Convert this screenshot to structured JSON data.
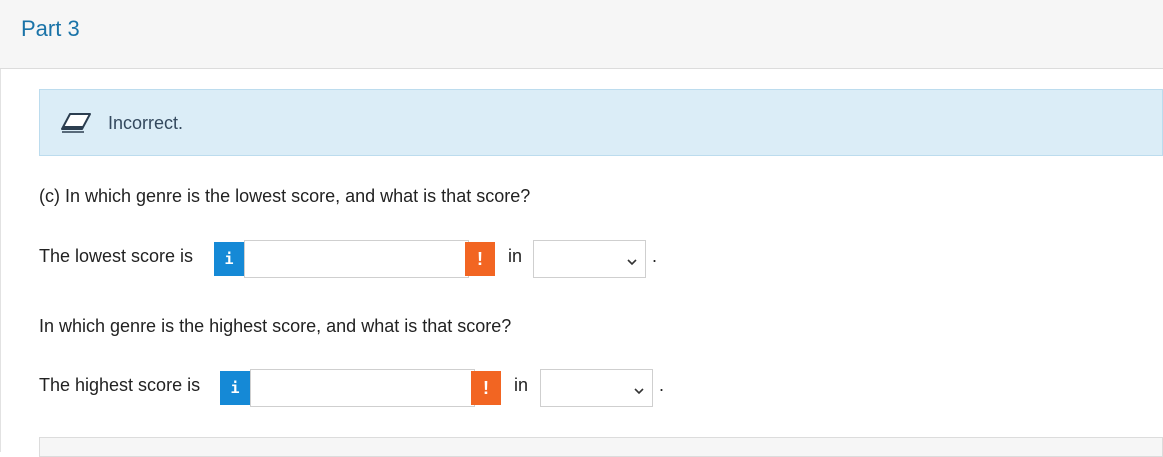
{
  "header": {
    "title": "Part 3"
  },
  "feedback": {
    "icon": "eraser-icon",
    "message": "Incorrect."
  },
  "question_c": {
    "text": "(c) In which genre is the lowest score, and what is that score?"
  },
  "lowest": {
    "label": "The lowest score is",
    "info_glyph": "i",
    "value": "",
    "warning_glyph": "!",
    "in_text": "in",
    "genre_selected": "",
    "period": "."
  },
  "question_high": {
    "text": "In which genre is the highest score, and what is that score?"
  },
  "highest": {
    "label": "The highest score is",
    "info_glyph": "i",
    "value": "",
    "warning_glyph": "!",
    "in_text": "in",
    "genre_selected": "",
    "period": "."
  },
  "colors": {
    "title": "#1a73a8",
    "alert_bg": "#dbedf7",
    "info_btn": "#1589d6",
    "warning_btn": "#f26522"
  }
}
